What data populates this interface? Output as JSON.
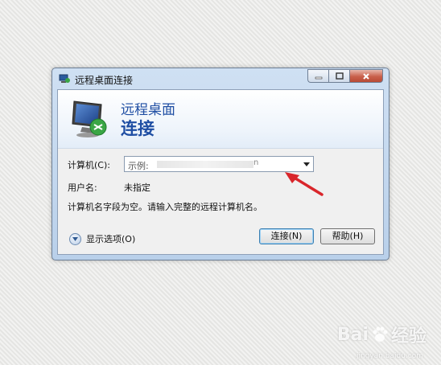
{
  "window": {
    "title": "远程桌面连接",
    "title_icon": "remote-desktop-icon"
  },
  "banner": {
    "line1": "远程桌面",
    "line2": "连接",
    "icon": "remote-desktop-monitor-icon"
  },
  "form": {
    "computer_label": "计算机(C):",
    "computer_value_prefix": "示例:",
    "computer_value_tail": "n",
    "username_label": "用户名:",
    "username_value": "未指定",
    "message": "计算机名字段为空。请输入完整的远程计算机名。"
  },
  "footer": {
    "options_label": "显示选项(O)",
    "connect_label": "连接(N)",
    "help_label": "帮助(H)"
  },
  "watermark": {
    "brand": "Bai",
    "brand2": "经验",
    "sub": "jingyan.baidu.com"
  },
  "colors": {
    "banner_text": "#1f4ea3",
    "arrow": "#d9262b"
  }
}
